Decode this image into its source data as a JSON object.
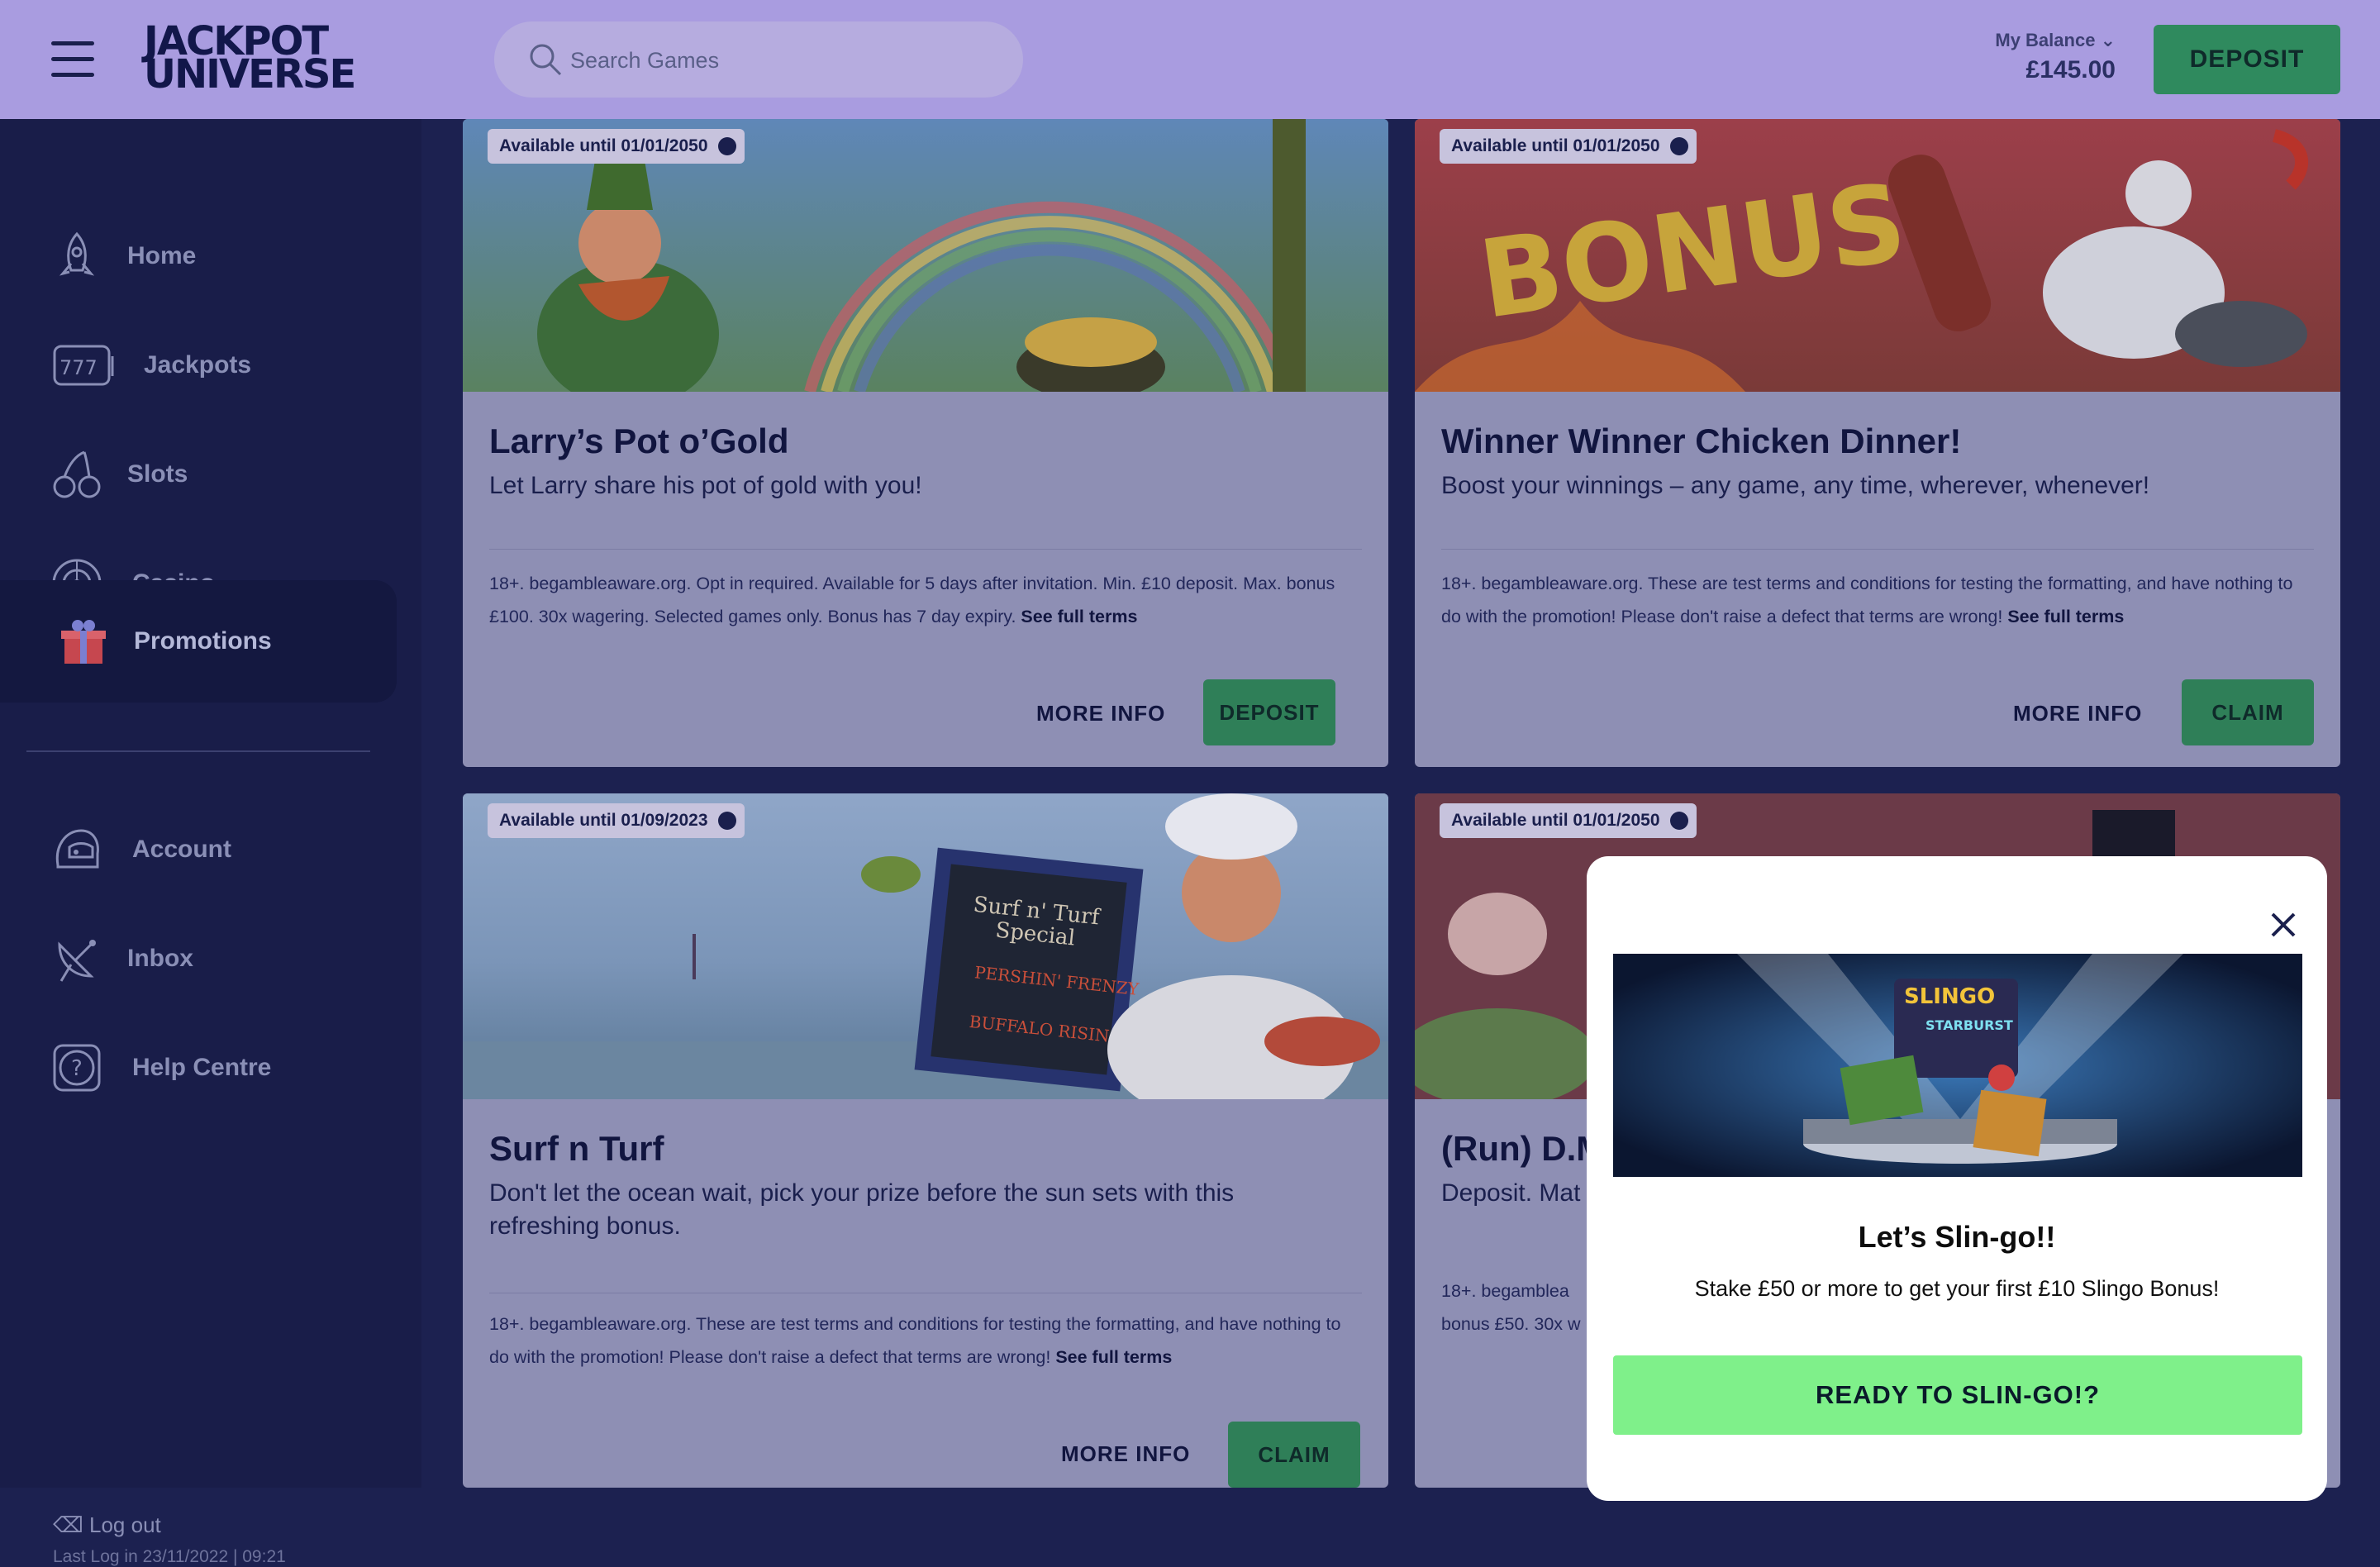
{
  "header": {
    "logo_line1": "JACKPOT",
    "logo_line2": "UNIVERSE",
    "search_placeholder": "Search Games",
    "balance_label": "My Balance",
    "balance_amount": "£145.00",
    "deposit_label": "DEPOSIT"
  },
  "sidebar": {
    "items": [
      {
        "label": "Home",
        "icon": "rocket-icon"
      },
      {
        "label": "Jackpots",
        "icon": "slot-machine-icon"
      },
      {
        "label": "Slots",
        "icon": "cherries-icon"
      },
      {
        "label": "Casino",
        "icon": "roulette-icon"
      },
      {
        "label": "Promotions",
        "icon": "gift-icon"
      },
      {
        "label": "Account",
        "icon": "astronaut-helmet-icon"
      },
      {
        "label": "Inbox",
        "icon": "satellite-dish-icon"
      },
      {
        "label": "Help Centre",
        "icon": "question-icon"
      }
    ],
    "logout_label": "Log out",
    "last_login": "Last Log in 23/11/2022 | 09:21"
  },
  "promotions": [
    {
      "available": "Available until 01/01/2050",
      "title": "Larry’s Pot o’Gold",
      "subtitle": "Let Larry share his pot of gold with you!",
      "terms": "18+. begambleaware.org. Opt in required. Available for 5 days after invitation. Min. £10 deposit. Max. bonus £100. 30x wagering. Selected games only. Bonus has 7 day expiry.",
      "terms_link": "See full terms",
      "more_label": "MORE INFO",
      "action_label": "DEPOSIT"
    },
    {
      "available": "Available until 01/01/2050",
      "title": "Winner Winner Chicken Dinner!",
      "subtitle": "Boost your winnings – any game, any time, wherever, whenever!",
      "terms": "18+. begambleaware.org. These are test terms and conditions for testing the formatting, and have nothing to do with the promotion! Please don't raise a defect that terms are wrong!",
      "terms_link": "See full terms",
      "more_label": "MORE INFO",
      "action_label": "CLAIM"
    },
    {
      "available": "Available until 01/09/2023",
      "title": "Surf n Turf",
      "subtitle": "Don't let the ocean wait,  pick your prize before the sun sets with this refreshing bonus.",
      "terms": "18+. begambleaware.org. These are test terms and conditions for testing the formatting, and have nothing to do with the promotion! Please don't raise a defect that terms are wrong!",
      "terms_link": "See full terms",
      "more_label": "MORE INFO",
      "action_label": "CLAIM"
    },
    {
      "available": "Available until 01/01/2050",
      "title": "(Run) D.M",
      "subtitle": "Deposit. Mat",
      "terms_line1": "18+. begamblea",
      "terms_line2": "bonus £50. 30x w"
    }
  ],
  "modal": {
    "title": "Let’s Slin-go!!",
    "message": "Stake £50 or more to get your first £10 Slingo Bonus!",
    "cta_label": "READY TO SLIN-GO!?",
    "hero_text1": "SLINGO",
    "hero_text2": "STARBURST"
  },
  "banners": {
    "surf_board_line1": "Surf n' Turf",
    "surf_board_line2": "Special",
    "surf_board_item1": "PERSHIN' FRENZY",
    "surf_board_item2": "BUFFALO RISING",
    "bonus_word": "BONUS"
  },
  "colors": {
    "header_bg": "#a99ce0",
    "sidebar_bg": "#191d49",
    "card_bg": "#8e8fb4",
    "deposit_green": "#2f8a5e",
    "cta_green": "#7ff08a"
  }
}
